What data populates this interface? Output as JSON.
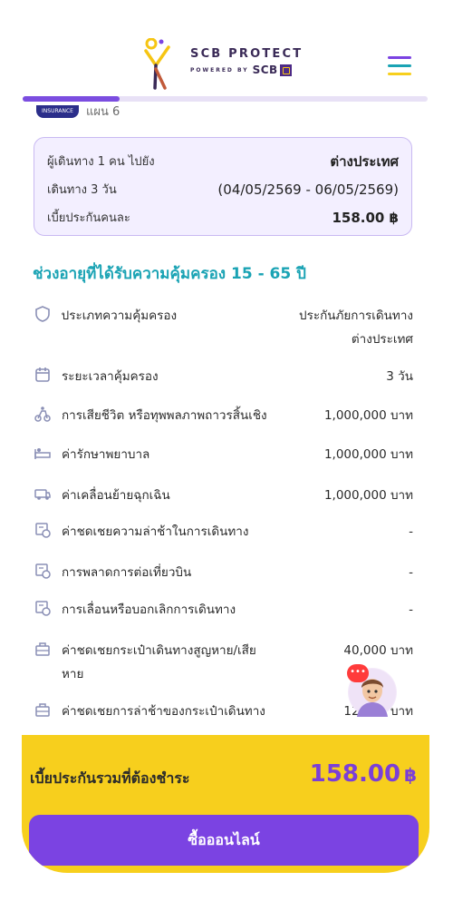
{
  "header": {
    "brand": "SCB PROTECT",
    "powered_by": "POWERED BY",
    "powered_brand": "SCB",
    "hamburger_colors": [
      "#7b43e2",
      "#1aa3b4",
      "#f7cf1d"
    ]
  },
  "progress": {
    "fraction": 0.24
  },
  "plan": {
    "badge": "INSURANCE",
    "name": "แผน 6"
  },
  "summary": {
    "rows": [
      {
        "label": "ผู้เดินทาง 1 คน ไปยัง",
        "value": "ต่างประเทศ"
      },
      {
        "label": "เดินทาง 3 วัน",
        "value": "(04/05/2569 - 06/05/2569)"
      },
      {
        "label": "เบี้ยประกันคนละ",
        "value": "158.00 ฿"
      }
    ]
  },
  "age_title": "ช่วงอายุที่ได้รับความคุ้มครอง 15 - 65 ปี",
  "coverage": [
    {
      "icon": "shield-icon",
      "label": "ประเภทความคุ้มครอง",
      "value": "ประกันภัยการเดินทาง ต่างประเทศ"
    },
    {
      "icon": "calendar-icon",
      "label": "ระยะเวลาคุ้มครอง",
      "value": "3 วัน"
    },
    {
      "icon": "accident-icon",
      "label": "การเสียชีวิต หรือทุพพลภาพถาวรสิ้นเชิง",
      "value": "1,000,000 บาท"
    },
    {
      "icon": "medical-bed-icon",
      "label": "ค่ารักษาพยาบาล",
      "value": "1,000,000 บาท"
    },
    {
      "icon": "ambulance-icon",
      "label": "ค่าเคลื่อนย้ายฉุกเฉิน",
      "value": "1,000,000 บาท"
    },
    {
      "icon": "delay-icon",
      "label": "ค่าชดเชยความล่าช้าในการเดินทาง",
      "value": "-"
    },
    {
      "icon": "flight-connection-icon",
      "label": "การพลาดการต่อเที่ยวบิน",
      "value": "-"
    },
    {
      "icon": "trip-cancel-icon",
      "label": "การเลื่อนหรือบอกเลิกการเดินทาง",
      "value": "-"
    },
    {
      "icon": "luggage-icon",
      "label": "ค่าชดเชยกระเป๋าเดินทางสูญหาย/เสียหาย",
      "value": "40,000 บาท"
    },
    {
      "icon": "luggage-delay-icon",
      "label": "ค่าชดเชยการล่าช้าของกระเป๋าเดินทาง",
      "value": "12,000 บาท"
    }
  ],
  "chat": {
    "badge": "•••"
  },
  "footer": {
    "total_label": "เบี้ยประกันรวมที่ต้องชำระ",
    "total_value": "158.00",
    "currency": "฿",
    "buy_label": "ซื้อออนไลน์"
  }
}
